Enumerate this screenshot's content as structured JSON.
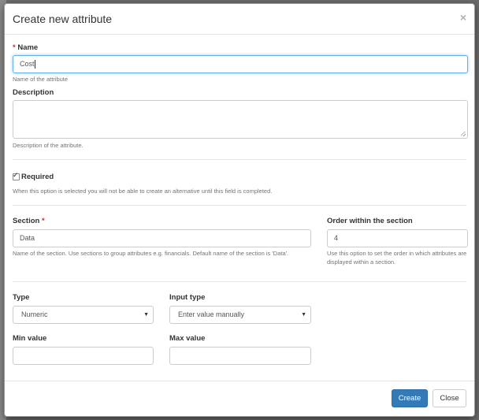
{
  "dialog": {
    "title": "Create new attribute",
    "close_glyph": "×"
  },
  "name": {
    "label": "Name",
    "required_mark": "*",
    "value": "Cost",
    "help": "Name of the attribute"
  },
  "description": {
    "label": "Description",
    "value": "",
    "help": "Description of the attribute."
  },
  "required": {
    "label": "Required",
    "checked": true,
    "help": "When this option is selected you will not be able to create an alternative until this field is completed."
  },
  "section": {
    "label": "Section",
    "required_mark": "*",
    "value": "Data",
    "help": "Name of the section. Use sections to group attributes e.g. financials. Default name of the section is 'Data'."
  },
  "order": {
    "label": "Order within the section",
    "value": "4",
    "help": "Use this option to set the order in which attributes are displayed within a section."
  },
  "type": {
    "label": "Type",
    "selected": "Numeric"
  },
  "input_type": {
    "label": "Input type",
    "selected": "Enter value manually"
  },
  "min_value": {
    "label": "Min value",
    "value": ""
  },
  "max_value": {
    "label": "Max value",
    "value": ""
  },
  "footer": {
    "create_label": "Create",
    "close_label": "Close"
  },
  "colors": {
    "primary": "#337ab7",
    "required": "#c9302c",
    "focus": "#66afe9"
  },
  "icons": {
    "close": "close-icon",
    "caret": "caret-down-icon",
    "checkbox": "checkbox-checked-icon"
  }
}
